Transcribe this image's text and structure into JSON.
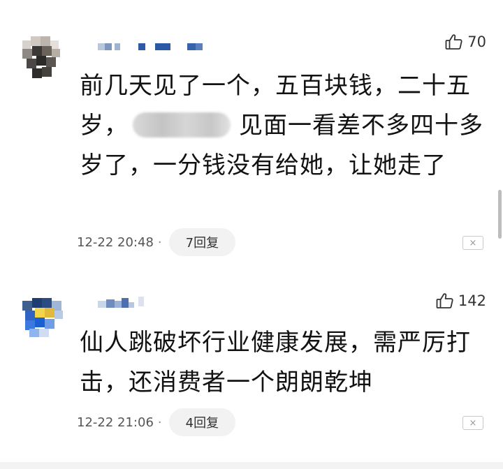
{
  "comments": [
    {
      "likes": "70",
      "content_parts": [
        "前几天见了一个，五百块钱，二十五岁，",
        "见面一看差不多四十多岁了，一分钱没有给她，让她走了"
      ],
      "time": "12-22 20:48",
      "dot": "·",
      "replies": "7回复"
    },
    {
      "likes": "142",
      "content": "仙人跳破坏行业健康发展，需严厉打击，还消费者一个朗朗乾坤",
      "time": "12-22 21:06",
      "dot": "·",
      "replies": "4回复"
    }
  ],
  "icons": {
    "like": "thumbs-up-icon",
    "close": "close-icon"
  },
  "close_glyph": "×"
}
